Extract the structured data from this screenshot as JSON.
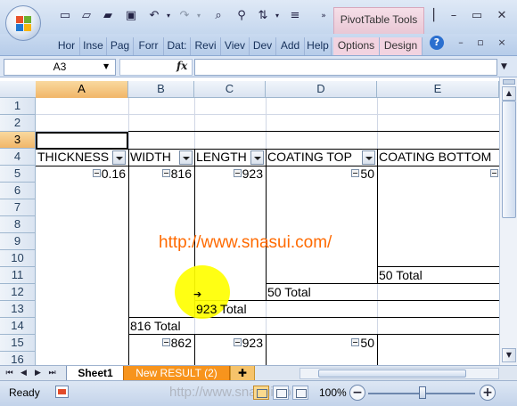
{
  "titlebar": {
    "contextual_tab_title": "PivotTable Tools"
  },
  "ribbon": {
    "tabs": [
      "Hor",
      "Inse",
      "Pag",
      "Forr",
      "Dat:",
      "Revi",
      "Viev",
      "Dev",
      "Add",
      "Help"
    ],
    "contextual_tabs": [
      "Options",
      "Design"
    ],
    "help_icon_label": "?"
  },
  "formula_bar": {
    "name_box": "A3",
    "fx_label": "fx",
    "formula": ""
  },
  "grid": {
    "columns": [
      "A",
      "B",
      "C",
      "D",
      "E"
    ],
    "selected_column": "A",
    "rows": [
      "1",
      "2",
      "3",
      "4",
      "5",
      "6",
      "7",
      "8",
      "9",
      "10",
      "11",
      "12",
      "13",
      "14",
      "15",
      "16"
    ],
    "selected_row": "3",
    "selected_cell": "A3"
  },
  "pivot": {
    "headers": [
      "THICKNESS",
      "WIDTH",
      "LENGTH",
      "COATING TOP",
      "COATING BOTTOM"
    ],
    "row5": [
      "0.16",
      "816",
      "923",
      "50",
      ""
    ],
    "totals": {
      "e11": "50 Total",
      "d12": "50 Total",
      "c13": "923 Total",
      "b14": "816 Total"
    },
    "row15": [
      "862",
      "923",
      "50"
    ]
  },
  "overlay": {
    "watermark": "http://www.snasui.com/"
  },
  "sheets": {
    "tabs": [
      "Sheet1",
      "New RESULT (2)"
    ],
    "active": "Sheet1"
  },
  "status": {
    "ready": "Ready",
    "watermark_faded": "http://www.snasui.com/",
    "zoom": "100%",
    "zoom_level": 1.0
  },
  "colors": {
    "accent_selected_header": "#f1b668",
    "watermark": "#ff6a00",
    "highlight": "#ffff00",
    "sheet_tab_new_result": "#f7941d"
  }
}
